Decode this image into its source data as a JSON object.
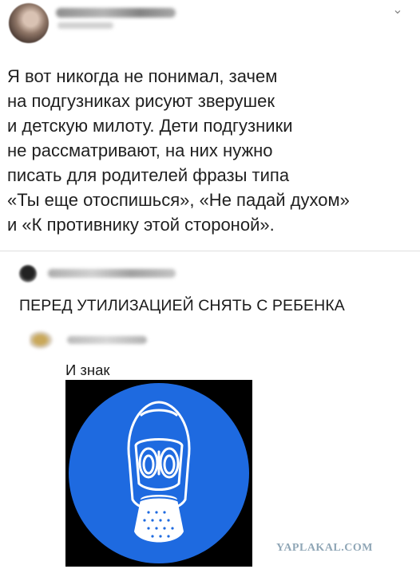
{
  "post": {
    "text_lines": [
      "Я вот никогда не понимал, зачем",
      "на подгузниках рисуют зверушек",
      "и детскую милоту. Дети подгузники",
      "не рассматривают, на них нужно",
      "писать для родителей фразы типа",
      "«Ты еще отоспишься», «Не падай духом»",
      "и «К противнику этой стороной»."
    ],
    "menu_icon": "chevron-down-icon"
  },
  "comments": [
    {
      "text": "ПЕРЕД УТИЛИЗАЦИЕЙ СНЯТЬ С РЕБЕНКА"
    },
    {
      "text": "И знак"
    }
  ],
  "sign": {
    "icon": "gas-mask-icon",
    "circle_color": "#1e6ae0",
    "background_color": "#000000",
    "mask_color": "#ffffff"
  },
  "watermark": {
    "text": "YAPLAKAL.COM",
    "color": "#8fa6b6"
  }
}
